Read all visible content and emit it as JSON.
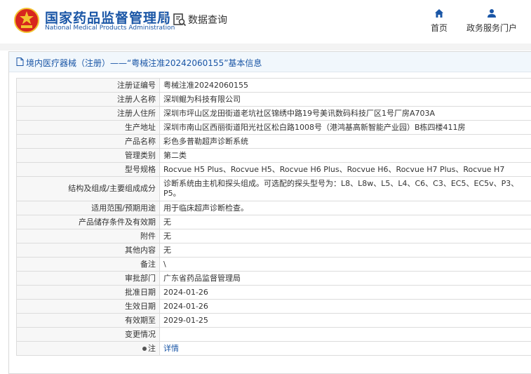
{
  "header": {
    "title_cn": "国家药品监督管理局",
    "title_en": "National Medical Products Administration",
    "query_label": "数据查询",
    "nav": {
      "home": "首页",
      "portal": "政务服务门户"
    }
  },
  "breadcrumb": "境内医疗器械（注册）——“粤械注准20242060155”基本信息",
  "rows": [
    {
      "label": "注册证编号",
      "value": "粤械注准20242060155"
    },
    {
      "label": "注册人名称",
      "value": "深圳鲲为科技有限公司"
    },
    {
      "label": "注册人住所",
      "value": "深圳市坪山区龙田街道老坑社区锦绣中路19号美讯数码科技厂区1号厂房A703A"
    },
    {
      "label": "生产地址",
      "value": "深圳市南山区西丽街道阳光社区松白路1008号（港鸿基高新智能产业园）B栋四楼411房"
    },
    {
      "label": "产品名称",
      "value": "彩色多普勒超声诊断系统"
    },
    {
      "label": "管理类别",
      "value": "第二类"
    },
    {
      "label": "型号规格",
      "value": "Rocvue H5 Plus、Rocvue H5、Rocvue H6 Plus、Rocvue H6、Rocvue H7 Plus、Rocvue H7"
    },
    {
      "label": "结构及组成/主要组成成分",
      "value": "诊断系统由主机和探头组成。可选配的探头型号为：L8、L8w、L5、L4、C6、C3、EC5、EC5v、P3、P5。"
    },
    {
      "label": "适用范围/预期用途",
      "value": "用于临床超声诊断检查。"
    },
    {
      "label": "产品储存条件及有效期",
      "value": "无"
    },
    {
      "label": "附件",
      "value": "无"
    },
    {
      "label": "其他内容",
      "value": "无"
    },
    {
      "label": "备注",
      "value": "\\"
    },
    {
      "label": "审批部门",
      "value": "广东省药品监督管理局"
    },
    {
      "label": "批准日期",
      "value": "2024-01-26"
    },
    {
      "label": "生效日期",
      "value": "2024-01-26"
    },
    {
      "label": "有效期至",
      "value": "2029-01-25"
    },
    {
      "label": "变更情况",
      "value": ""
    },
    {
      "label": "注",
      "value": "详情"
    }
  ],
  "icons": {
    "emblem": "national-emblem-icon",
    "query": "data-query-icon",
    "home": "home-icon",
    "portal": "user-icon",
    "crumb": "document-icon",
    "note": "info-dot-icon"
  },
  "colors": {
    "brand": "#1a56a6",
    "emblem_red": "#d7261e",
    "emblem_gold": "#f2c230"
  }
}
